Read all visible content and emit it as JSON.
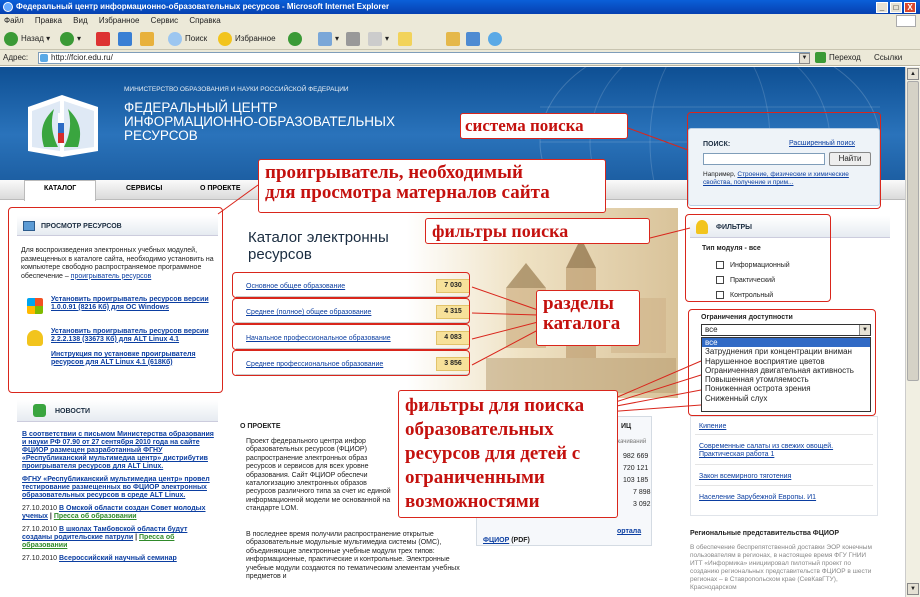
{
  "window": {
    "title": "Федеральный центр информационно-образовательных ресурсов - Microsoft Internet Explorer",
    "min": "_",
    "max": "□",
    "close": "X"
  },
  "menu": [
    "Файл",
    "Правка",
    "Вид",
    "Избранное",
    "Сервис",
    "Справка"
  ],
  "toolbar": {
    "back": "Назад",
    "search": "Поиск",
    "favorites": "Избранное"
  },
  "address": {
    "label": "Адрес:",
    "url": "http://fcior.edu.ru/",
    "go": "Переход",
    "links": "Ссылки"
  },
  "header": {
    "ministry": "МИНИСТЕРСТВО ОБРАЗОВАНИЯ И НАУКИ РОССИЙСКОЙ ФЕДЕРАЦИИ",
    "line1": "ФЕДЕРАЛЬНЫЙ ЦЕНТР",
    "line2": "ИНФОРМАЦИОННО-ОБРАЗОВАТЕЛЬНЫХ",
    "line3": "РЕСУРСОВ"
  },
  "nav": [
    "КАТАЛОГ",
    "СЕРВИСЫ",
    "О ПРОЕКТЕ"
  ],
  "search": {
    "label": "ПОИСК:",
    "advanced": "Расширенный поиск",
    "button": "Найти",
    "example_prefix": "Например, ",
    "example_link": "Строение, физические и химические свойства, получение и прим..."
  },
  "viewer": {
    "title": "ПРОСМОТР РЕСУРСОВ",
    "text": "Для воспроизведения электронных учебных модулей, размещенных в каталоге сайта, необходимо установить на компьютере свободно распространяемое программное обеспечение – ",
    "text_link": "проигрыватель ресурсов",
    "win_link": "Установить проигрыватель ресурсов версии 1.0.0.91 (8216 Кб) для ОС Windows",
    "alt_link": "Установить проигрыватель ресурсов версии 2.2.2.138 (33673 Кб) для ALT Linux 4.1",
    "alt_instr": "Инструкция по установке проигрывателя ресурсов для ALT Linux 4.1 (618Кб)"
  },
  "news": {
    "title": "НОВОСТИ",
    "item1": "В соответствии с письмом Министерства образования и науки РФ 07.90 от 27 сентября 2010 года на сайте ФЦИОР размещен разработанный ФГНУ «Республиканский мультимедиа центр» дистрибутив проигрывателя ресурсов для ALT Linux.",
    "item2": "ФГНУ «Республиканский мультимедиа центр» провел тестирование размещенных во ФЦИОР электронных образовательных ресурсов в среде ALT Linux.",
    "d3": "27.10.2010",
    "t3": "В Омской области создан Совет молодых ученых",
    "s3": "Пресса об образовании",
    "d4": "27.10.2010",
    "t4": "В школах Тамбовской области будут созданы родительские патрули",
    "s4": "Пресса об образовании",
    "d5": "27.10.2010",
    "t5": "Всероссийский научный семинар"
  },
  "catalog": {
    "title1": "Каталог электронны",
    "title2": "ресурсов",
    "rows": [
      {
        "label": "Основное общее образование",
        "count": "7 030"
      },
      {
        "label": "Среднее (полное) общее образование",
        "count": "4 315"
      },
      {
        "label": "Начальное профессиональное образование",
        "count": "4 083"
      },
      {
        "label": "Среднее профессиональное образование",
        "count": "3 856"
      }
    ]
  },
  "about": {
    "title": "О ПРОЕКТЕ",
    "p1": "Проект федерального центра инфор образовательных ресурсов (ФЦИОР) распространение электронных образ ресурсов и сервисов для всех уровне образования. Сайт ФЦИОР обеспечи каталогизацию электронных образов ресурсов различного типа за счет ис единой информационной модели ме основанной на стандарте LOM.",
    "p2": "В последнее время получили распространение открытые образовательные модульные мультимедиа системы (ОМС), объединяющие электронные учебные модули трех типов: информационные, практические и контрольные. Электронные учебные модули создаются по тематическим элементам учебных предметов и",
    "stats_title": "ИЦ",
    "stats_sub": "Скачиваний",
    "stats": [
      "982 669",
      "720 121",
      "103 185",
      "7 898",
      "3 092"
    ],
    "fcior_link": "ФЦИОР",
    "pdf": "(PDF)",
    "portal": "ортала"
  },
  "filters": {
    "title": "ФИЛЬТРЫ",
    "module_type": "Тип модуля - все",
    "types": [
      "Информационный",
      "Практический",
      "Контрольный"
    ],
    "access_title": "Ограничения доступности",
    "selected": "все",
    "options": [
      "все",
      "Затруднения при концентрации вниман",
      "Нарушенное восприятие цветов",
      "Ограниченная двигательная активность",
      "Повышенная утомляемость",
      "Пониженная острота зрения",
      "Сниженный слух"
    ]
  },
  "popular": [
    "Кипение",
    "Современные салаты из свежих овощей. Практическая работа 1",
    "Закон всемирного тяготения",
    "Население Зарубежной Европы. И1"
  ],
  "regions": {
    "title": "Региональные представительства ФЦИОР",
    "text": "В обеспечение беспрепятственной доставки ЭОР конечным пользователям в регионах, в настоящее время ФГУ ГНИИ ИТТ «Информика» инициировал пилотный проект по созданию региональных представительств ФЦИОР в шести регионах – в Ставропольском крае (СевКавГТУ), Краснодарском"
  },
  "annotations": {
    "search": "система поиска",
    "player1": "проигрыватель, необходимый",
    "player2": "для просмотра матерналов сайта",
    "filters": "фильтры поиска",
    "sections1": "разделы",
    "sections2": "каталога",
    "access1": "фильтры для поиска",
    "access2": "образовательных",
    "access3": "ресурсов для детей с",
    "access4": "ограниченными",
    "access5": "возможностями"
  },
  "colors": {
    "annotation": "#d9261c",
    "header": "#1a5fa6",
    "count_bg": "#f7e19a",
    "link": "#0b3ea1"
  }
}
